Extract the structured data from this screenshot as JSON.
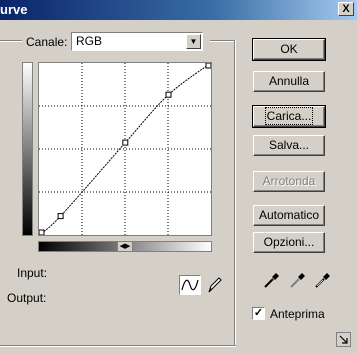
{
  "window": {
    "title": "urve",
    "close_label": "X"
  },
  "channel": {
    "label": "Canale:",
    "value": "RGB"
  },
  "buttons": {
    "ok": "OK",
    "cancel": "Annulla",
    "load": "Carica...",
    "save": "Salva...",
    "smooth": "Arrotonda",
    "auto": "Automatico",
    "options": "Opzioni..."
  },
  "readouts": {
    "input_label": "Input:",
    "output_label": "Output:"
  },
  "preview": {
    "label": "Anteprima",
    "checked": true
  },
  "curve": {
    "control_points": [
      {
        "input": 0,
        "output": 0
      },
      {
        "input": 32,
        "output": 28
      },
      {
        "input": 128,
        "output": 137
      },
      {
        "input": 192,
        "output": 208
      },
      {
        "input": 255,
        "output": 255
      }
    ]
  },
  "eyedroppers": [
    "black-point-eyedropper",
    "gray-point-eyedropper",
    "white-point-eyedropper"
  ]
}
